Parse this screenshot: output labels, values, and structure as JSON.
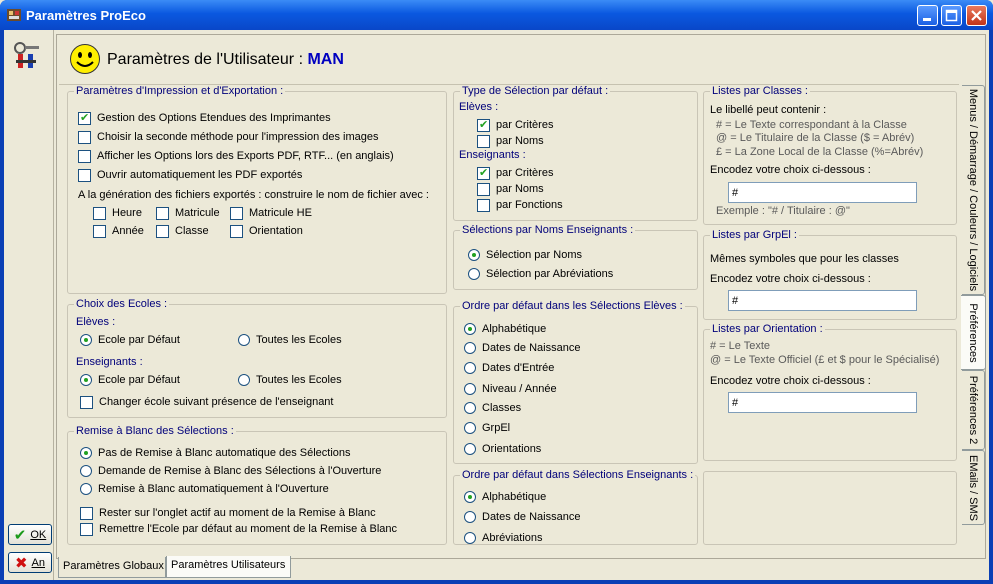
{
  "window": {
    "title": "Paramètres ProEco"
  },
  "header": {
    "title": "Paramètres de l'Utilisateur :",
    "user": "MAN"
  },
  "impression": {
    "legend": "Paramètres d'Impression et d'Exportation :",
    "options": [
      {
        "label": "Gestion des Options Etendues des Imprimantes",
        "checked": true
      },
      {
        "label": "Choisir la seconde méthode pour l'impression des images",
        "checked": false
      },
      {
        "label": "Afficher les Options lors des Exports PDF, RTF... (en anglais)",
        "checked": false
      },
      {
        "label": "Ouvrir automatiquement les PDF exportés",
        "checked": false
      }
    ],
    "filename_label": "A la génération des fichiers exportés : construire le nom de fichier avec :",
    "filename_options": [
      "Heure",
      "Matricule",
      "Matricule HE",
      "Année",
      "Classe",
      "Orientation"
    ]
  },
  "ecoles": {
    "legend": "Choix des Ecoles :",
    "eleves_label": "Elèves :",
    "enseignants_label": "Enseignants :",
    "ecole_defaut": "Ecole par Défaut",
    "toutes": "Toutes les Ecoles",
    "changer": "Changer école suivant présence de l'enseignant"
  },
  "remise": {
    "legend": "Remise à Blanc des Sélections :",
    "radios": [
      "Pas de Remise à Blanc automatique des Sélections",
      "Demande de Remise à Blanc des Sélections à l'Ouverture",
      "Remise à Blanc automatiquement à l'Ouverture"
    ],
    "checks": [
      "Rester sur l'onglet actif au moment de la Remise à Blanc",
      "Remettre l'Ecole par défaut au moment de la Remise à Blanc"
    ]
  },
  "type_selection": {
    "legend": "Type de Sélection par défaut :",
    "eleves_label": "Elèves :",
    "eleves_options": [
      {
        "label": "par Critères",
        "checked": true
      },
      {
        "label": "par Noms",
        "checked": false
      }
    ],
    "enseignants_label": "Enseignants :",
    "enseignants_options": [
      {
        "label": "par Critères",
        "checked": true
      },
      {
        "label": "par Noms",
        "checked": false
      },
      {
        "label": "par Fonctions",
        "checked": false
      }
    ]
  },
  "noms_enseignants": {
    "legend": "Sélections par Noms Enseignants :",
    "options": [
      "Sélection par Noms",
      "Sélection par Abréviations"
    ]
  },
  "ordre_eleves": {
    "legend": "Ordre par défaut dans les Sélections Elèves :",
    "options": [
      "Alphabétique",
      "Dates de Naissance",
      "Dates d'Entrée",
      "Niveau / Année",
      "Classes",
      "GrpEl",
      "Orientations"
    ]
  },
  "ordre_enseignants": {
    "legend": "Ordre par défaut dans Sélections Enseignants :",
    "options": [
      "Alphabétique",
      "Dates de Naissance",
      "Abréviations"
    ]
  },
  "listes_classes": {
    "legend": "Listes par Classes :",
    "intro": "Le libellé peut contenir :",
    "lines": [
      "# = Le Texte correspondant à la Classe",
      "@ = Le Titulaire de la Classe ($ = Abrév)",
      "£ = La Zone Local de la Classe (%=Abrév)"
    ],
    "encode_label": "Encodez votre choix ci-dessous :",
    "value": "#",
    "example": "Exemple : \"# / Titulaire : @\""
  },
  "listes_grpel": {
    "legend": "Listes par GrpEl :",
    "intro": "Mêmes symboles que pour les classes",
    "encode_label": "Encodez votre choix ci-dessous :",
    "value": "#"
  },
  "listes_orientation": {
    "legend": "Listes par Orientation :",
    "lines": [
      "# = Le Texte",
      "@ = Le Texte Officiel (£ et $ pour le Spécialisé)"
    ],
    "encode_label": "Encodez votre choix ci-dessous :",
    "value": "#"
  },
  "right_tabs": [
    "Menus / Démarrage / Couleurs / Logiciels",
    "Préférences",
    "Préférences 2",
    "EMails / SMS"
  ],
  "bottom_tabs": [
    "Paramètres Globaux",
    "Paramètres Utilisateurs"
  ],
  "buttons": {
    "ok": "OK",
    "an": "An"
  }
}
